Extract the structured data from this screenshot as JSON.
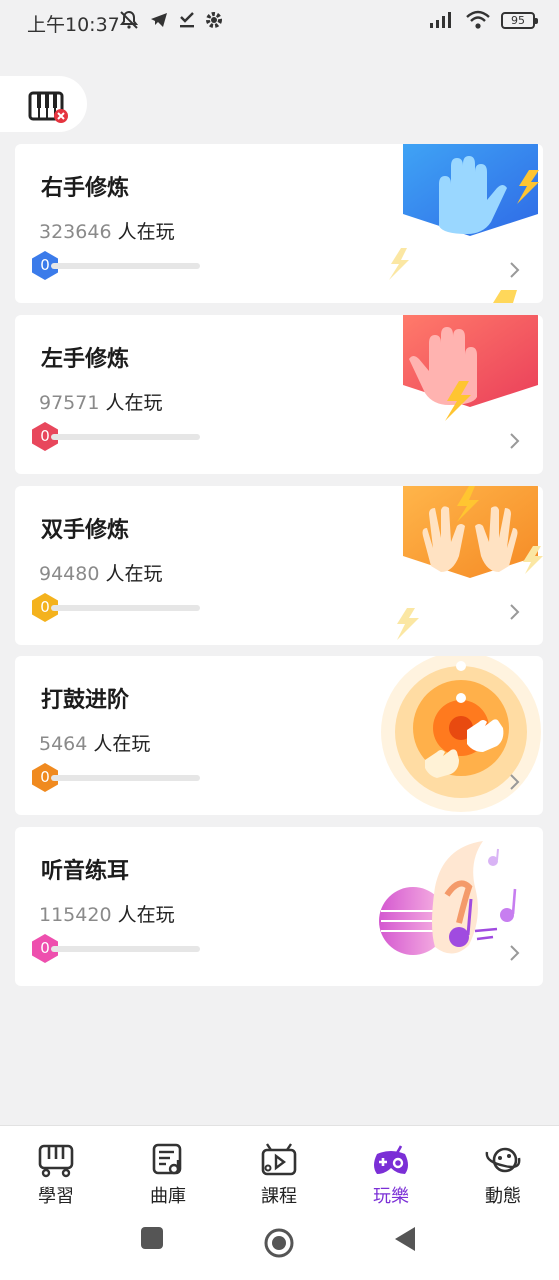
{
  "status_bar": {
    "time": "上午10:37",
    "battery": "95"
  },
  "cards": [
    {
      "title": "右手修炼",
      "count": "323646",
      "suffix": " 人在玩",
      "level": "0",
      "progress": 0,
      "badge_color": "#3b7bea"
    },
    {
      "title": "左手修炼",
      "count": "97571",
      "suffix": " 人在玩",
      "level": "0",
      "progress": 0,
      "badge_color": "#e8475c"
    },
    {
      "title": "双手修炼",
      "count": "94480",
      "suffix": " 人在玩",
      "level": "0",
      "progress": 0,
      "badge_color": "#f4b21d"
    },
    {
      "title": "打鼓进阶",
      "count": "5464",
      "suffix": " 人在玩",
      "level": "0",
      "progress": 0,
      "badge_color": "#f08a1f"
    },
    {
      "title": "听音练耳",
      "count": "115420",
      "suffix": " 人在玩",
      "level": "0",
      "progress": 0,
      "badge_color": "#ee4fae"
    }
  ],
  "nav": {
    "items": [
      {
        "label": "學習"
      },
      {
        "label": "曲庫"
      },
      {
        "label": "課程"
      },
      {
        "label": "玩樂"
      },
      {
        "label": "動態"
      }
    ],
    "active_color": "#7b2fd6"
  }
}
